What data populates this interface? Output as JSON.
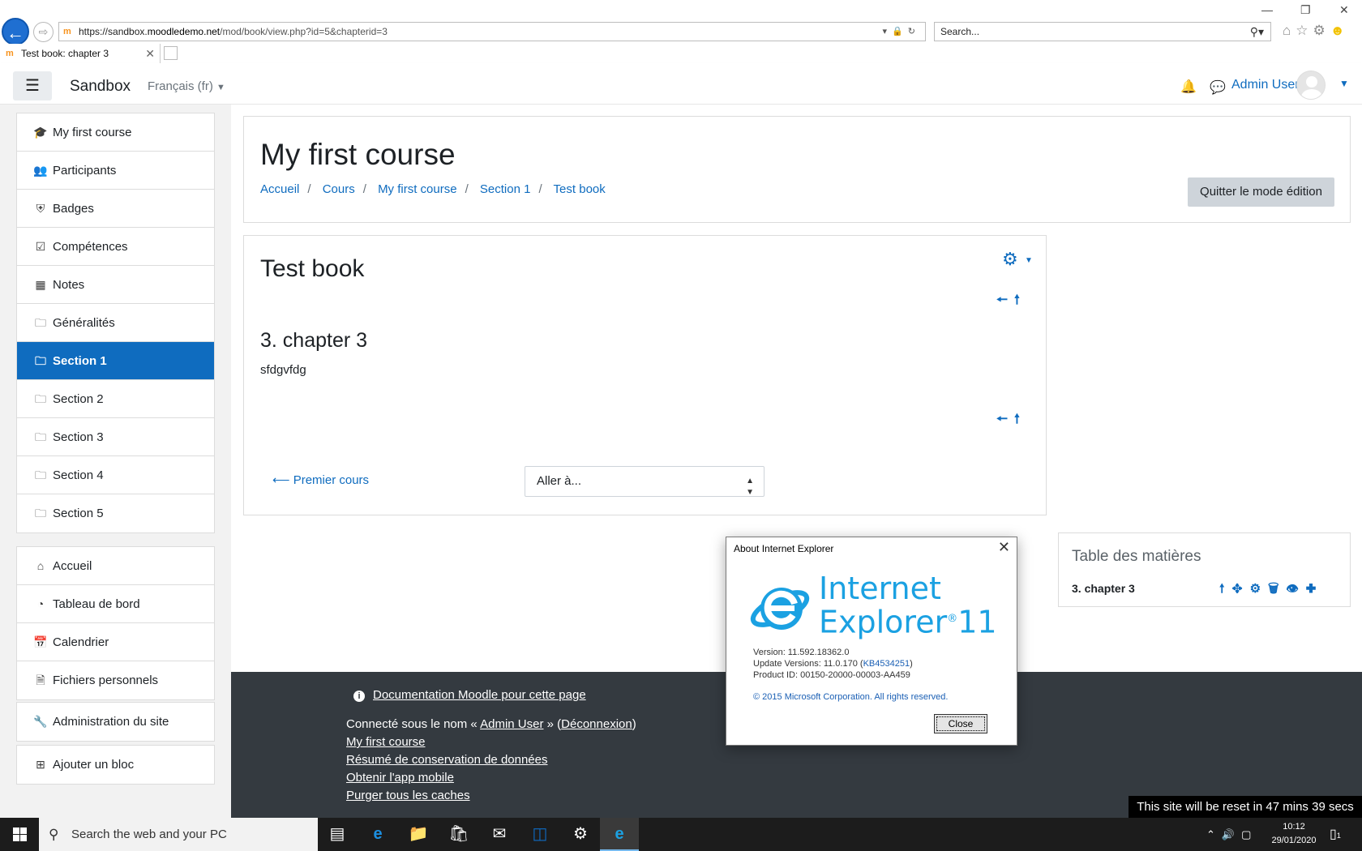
{
  "browser": {
    "url_prefix": "https://sandbox.",
    "url_host": "moodledemo.net",
    "url_path": "/mod/book/view.php?id=5&chapterid=3",
    "search_placeholder": "Search...",
    "tab_title": "Test book: chapter 3"
  },
  "navbar": {
    "brand": "Sandbox",
    "language": "Français (fr)",
    "user": "Admin User"
  },
  "drawer": {
    "course_items": [
      {
        "icon": "graduation-cap-icon",
        "label": "My first course"
      },
      {
        "icon": "users-icon",
        "label": "Participants"
      },
      {
        "icon": "shield-icon",
        "label": "Badges"
      },
      {
        "icon": "checkbox-icon",
        "label": "Compétences"
      },
      {
        "icon": "table-icon",
        "label": "Notes"
      },
      {
        "icon": "folder-icon",
        "label": "Généralités"
      },
      {
        "icon": "folder-icon",
        "label": "Section 1"
      },
      {
        "icon": "folder-icon",
        "label": "Section 2"
      },
      {
        "icon": "folder-icon",
        "label": "Section 3"
      },
      {
        "icon": "folder-icon",
        "label": "Section 4"
      },
      {
        "icon": "folder-icon",
        "label": "Section 5"
      }
    ],
    "site_items": [
      {
        "icon": "home-icon",
        "label": "Accueil"
      },
      {
        "icon": "dashboard-icon",
        "label": "Tableau de bord"
      },
      {
        "icon": "calendar-icon",
        "label": "Calendrier"
      },
      {
        "icon": "file-icon",
        "label": "Fichiers personnels"
      }
    ],
    "admin_item": {
      "icon": "wrench-icon",
      "label": "Administration du site"
    },
    "add_block_item": {
      "icon": "plus-square-icon",
      "label": "Ajouter un bloc"
    }
  },
  "header": {
    "course_title": "My first course",
    "breadcrumb": [
      "Accueil",
      "Cours",
      "My first course",
      "Section 1",
      "Test book"
    ],
    "edit_button": "Quitter le mode édition"
  },
  "book": {
    "title": "Test book",
    "chapter_title": "3. chapter 3",
    "chapter_text": "sfdgvfdg",
    "prev_link": "Premier cours",
    "goto_select": "Aller à..."
  },
  "toc": {
    "title": "Table des matières",
    "chapter": "3. chapter 3"
  },
  "footer": {
    "doc_link": "Documentation Moodle pour cette page",
    "login_prefix": "Connecté sous le nom « ",
    "login_user": "Admin User",
    "login_mid": " » (",
    "logout": "Déconnexion",
    "login_suffix": ")",
    "links": [
      "My first course",
      "Résumé de conservation de données",
      "Obtenir l'app mobile",
      "Purger tous les caches"
    ],
    "reset_banner": "This site will be reset in 47 mins 39 secs"
  },
  "about_dialog": {
    "title": "About Internet Explorer",
    "product_line1": "Internet",
    "product_line2": "Explorer",
    "product_version_mark": "11",
    "version": "Version: 11.592.18362.0",
    "update_prefix": "Update Versions: 11.0.170 (",
    "update_kb": "KB4534251",
    "update_suffix": ")",
    "product_id": "Product ID: 00150-20000-00003-AA459",
    "copyright": "© 2015 Microsoft Corporation. All rights reserved.",
    "close_button": "Close"
  },
  "taskbar": {
    "search_text": "Search the web and your PC",
    "time": "10:12",
    "date": "29/01/2020",
    "notification_count": "1"
  },
  "colors": {
    "moodle_blue": "#0f6cbf",
    "footer_bg": "#343a40",
    "ie_blue": "#1ba1e2"
  }
}
